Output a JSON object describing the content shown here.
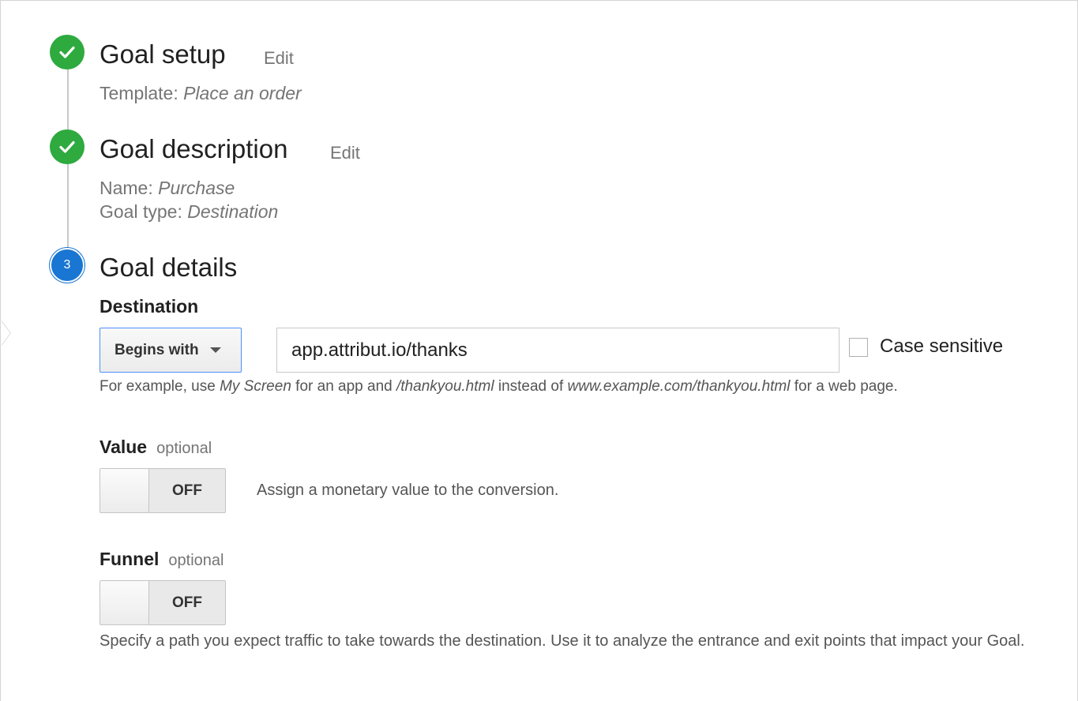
{
  "steps": [
    {
      "title": "Goal setup",
      "edit_label": "Edit",
      "status": "complete",
      "details": [
        {
          "label": "Template: ",
          "value": "Place an order"
        }
      ]
    },
    {
      "title": "Goal description",
      "edit_label": "Edit",
      "status": "complete",
      "details": [
        {
          "label": "Name: ",
          "value": "Purchase"
        },
        {
          "label": "Goal type: ",
          "value": "Destination"
        }
      ]
    },
    {
      "title": "Goal details",
      "number": "3",
      "status": "current"
    }
  ],
  "destination": {
    "label": "Destination",
    "match_type": "Begins with",
    "value": "app.attribut.io/thanks",
    "case_sensitive_label": "Case sensitive",
    "case_sensitive": false,
    "hint": {
      "p1": "For example, use ",
      "e1": "My Screen",
      "p2": " for an app and ",
      "e2": "/thankyou.html",
      "p3": " instead of ",
      "e3": "www.example.com/thankyou.html",
      "p4": " for a web page."
    }
  },
  "value": {
    "label": "Value",
    "optional": "optional",
    "toggle_state": "OFF",
    "description": "Assign a monetary value to the conversion."
  },
  "funnel": {
    "label": "Funnel",
    "optional": "optional",
    "toggle_state": "OFF",
    "description": "Specify a path you expect traffic to take towards the destination. Use it to analyze the entrance and exit points that impact your Goal."
  },
  "colors": {
    "complete": "#2eaa3f",
    "current": "#1976d2",
    "focus_border": "#4d90fe"
  }
}
